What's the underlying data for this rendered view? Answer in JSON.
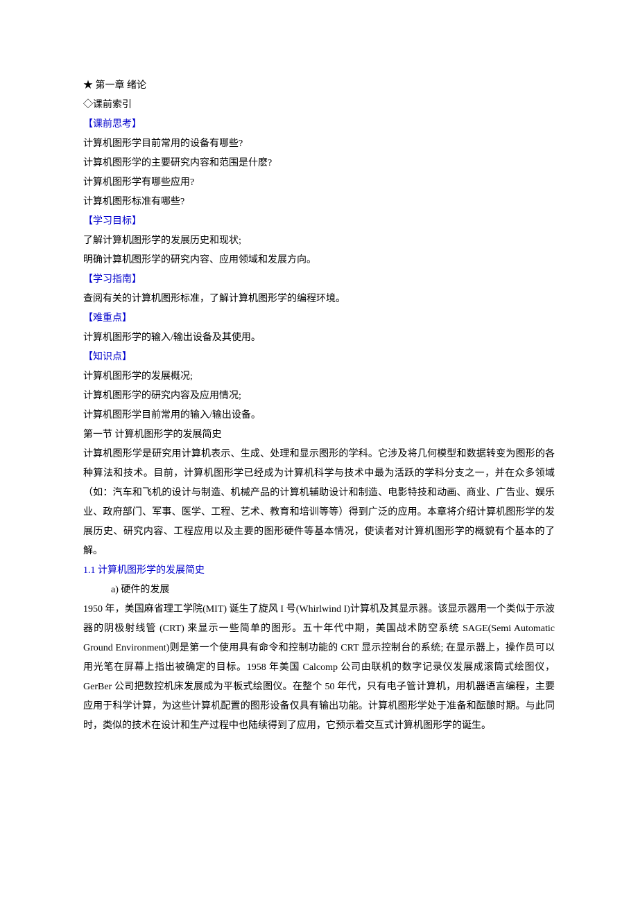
{
  "chapter_title": "★ 第一章 绪论",
  "preface_index": "◇课前索引",
  "section_thinking_header": "【课前思考】",
  "thinking_q1": "计算机图形学目前常用的设备有哪些?",
  "thinking_q2": "计算机图形学的主要研究内容和范围是什麽?",
  "thinking_q3": "计算机图形学有哪些应用?",
  "thinking_q4": "计算机图形标准有哪些?",
  "section_goal_header": "【学习目标】",
  "goal_1": "了解计算机图形学的发展历史和现状;",
  "goal_2": "明确计算机图形学的研究内容、应用领域和发展方向。",
  "section_guide_header": "【学习指南】",
  "guide_1": "查阅有关的计算机图形标准，了解计算机图形学的编程环境。",
  "section_difficulty_header": "【难重点】",
  "difficulty_1": "计算机图形学的输入/输出设备及其使用。",
  "section_knowledge_header": "【知识点】",
  "knowledge_1": "计算机图形学的发展概况;",
  "knowledge_2": "计算机图形学的研究内容及应用情况;",
  "knowledge_3": "计算机图形学目前常用的输入/输出设备。",
  "section_1_title": "第一节  计算机图形学的发展简史",
  "intro_paragraph": "计算机图形学是研究用计算机表示、生成、处理和显示图形的学科。它涉及将几何模型和数据转变为图形的各种算法和技术。目前，计算机图形学已经成为计算机科学与技术中最为活跃的学科分支之一，并在众多领域（如：汽车和飞机的设计与制造、机械产品的计算机辅助设计和制造、电影特技和动画、商业、广告业、娱乐业、政府部门、军事、医学、工程、艺术、教育和培训等等）得到广泛的应用。本章将介绍计算机图形学的发展历史、研究内容、工程应用以及主要的图形硬件等基本情况，使读者对计算机图形学的概貌有个基本的了解。",
  "subsection_1_1": "1.1 计算机图形学的发展简史",
  "subsection_a": "a) 硬件的发展",
  "hardware_paragraph": "1950 年，美国麻省理工学院(MIT) 诞生了旋风 I 号(Whirlwind I)计算机及其显示器。该显示器用一个类似于示波器的阴极射线管 (CRT) 来显示一些简单的图形。五十年代中期，美国战术防空系统 SAGE(Semi Automatic Ground Environment)则是第一个使用具有命令和控制功能的 CRT 显示控制台的系统; 在显示器上，操作员可以用光笔在屏幕上指出被确定的目标。1958 年美国 Calcomp 公司由联机的数字记录仪发展成滚筒式绘图仪，GerBer 公司把数控机床发展成为平板式绘图仪。在整个 50 年代，只有电子管计算机，用机器语言编程，主要应用于科学计算，为这些计算机配置的图形设备仅具有输出功能。计算机图形学处于准备和酝酿时期。与此同时，类似的技术在设计和生产过程中也陆续得到了应用，它预示着交互式计算机图形学的诞生。"
}
